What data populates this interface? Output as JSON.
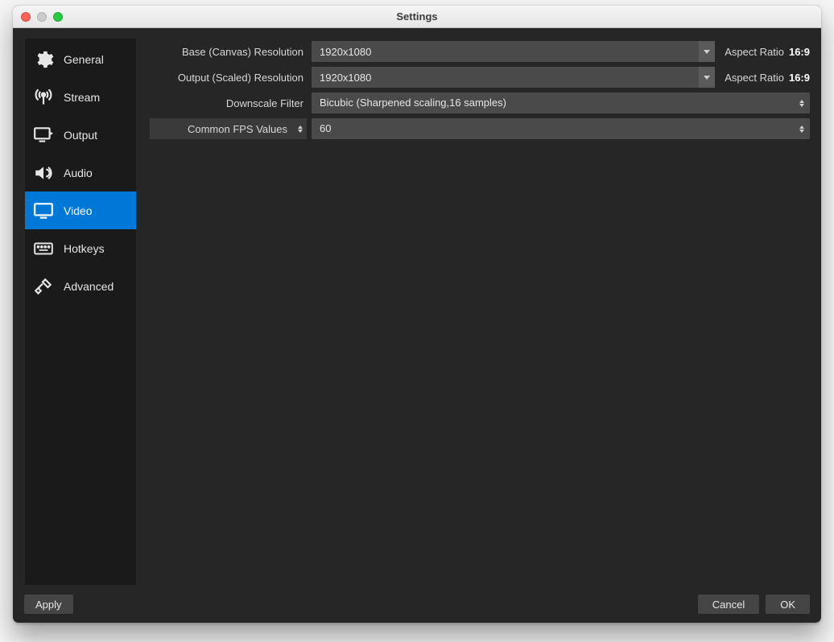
{
  "window": {
    "title": "Settings"
  },
  "sidebar": {
    "items": [
      {
        "id": "general",
        "label": "General"
      },
      {
        "id": "stream",
        "label": "Stream"
      },
      {
        "id": "output",
        "label": "Output"
      },
      {
        "id": "audio",
        "label": "Audio"
      },
      {
        "id": "video",
        "label": "Video"
      },
      {
        "id": "hotkeys",
        "label": "Hotkeys"
      },
      {
        "id": "advanced",
        "label": "Advanced"
      }
    ],
    "active_id": "video"
  },
  "video": {
    "base_resolution": {
      "label": "Base (Canvas) Resolution",
      "value": "1920x1080",
      "aspect_label": "Aspect Ratio",
      "aspect_value": "16:9"
    },
    "output_resolution": {
      "label": "Output (Scaled) Resolution",
      "value": "1920x1080",
      "aspect_label": "Aspect Ratio",
      "aspect_value": "16:9"
    },
    "downscale_filter": {
      "label": "Downscale Filter",
      "value": "Bicubic (Sharpened scaling,16 samples)"
    },
    "fps": {
      "label": "Common FPS Values",
      "value": "60"
    }
  },
  "footer": {
    "apply": "Apply",
    "cancel": "Cancel",
    "ok": "OK"
  }
}
